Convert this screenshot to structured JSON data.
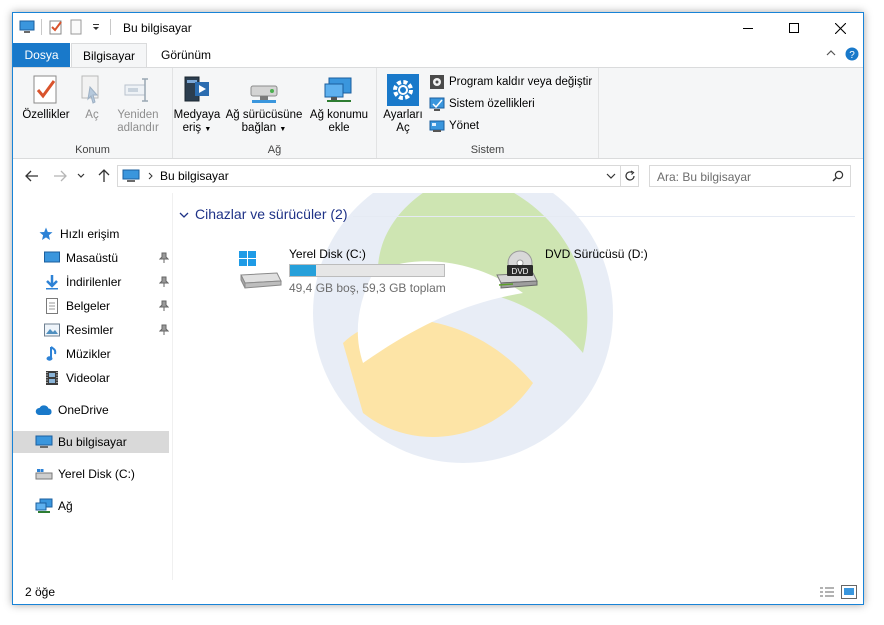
{
  "window": {
    "title": "Bu bilgisayar"
  },
  "ribbon": {
    "tabs": {
      "file": "Dosya",
      "computer": "Bilgisayar",
      "view": "Görünüm"
    },
    "groups": {
      "location": {
        "label": "Konum",
        "properties": "Özellikler",
        "open": "Aç",
        "rename_line1": "Yeniden",
        "rename_line2": "adlandır"
      },
      "network": {
        "label": "Ağ",
        "media_line1": "Medyaya",
        "media_line2": "eriş",
        "map_drive_line1": "Ağ sürücüsüne",
        "map_drive_line2": "bağlan",
        "add_location_line1": "Ağ konumu",
        "add_location_line2": "ekle"
      },
      "system": {
        "label": "Sistem",
        "settings_line1": "Ayarları",
        "settings_line2": "Aç",
        "uninstall": "Program kaldır veya değiştir",
        "system_properties": "Sistem özellikleri",
        "manage": "Yönet"
      }
    }
  },
  "address": {
    "path": "Bu bilgisayar"
  },
  "search": {
    "placeholder": "Ara: Bu bilgisayar"
  },
  "navpane": {
    "quick_access": "Hızlı erişim",
    "desktop": "Masaüstü",
    "downloads": "İndirilenler",
    "documents": "Belgeler",
    "pictures": "Resimler",
    "music": "Müzikler",
    "videos": "Videolar",
    "onedrive": "OneDrive",
    "this_pc": "Bu bilgisayar",
    "local_disk": "Yerel Disk (C:)",
    "network": "Ağ"
  },
  "content": {
    "group_header": "Cihazlar ve sürücüler (2)",
    "drives": [
      {
        "name": "Yerel Disk (C:)",
        "info": "49,4 GB boş, 59,3 GB toplam",
        "used_fraction": 0.167
      },
      {
        "name": "DVD Sürücüsü (D:)",
        "badge": "DVD"
      }
    ]
  },
  "status": {
    "item_count": "2 öğe"
  },
  "colors": {
    "accent": "#1979ca",
    "progress": "#26a0da",
    "group_header": "#1e3287",
    "selection": "#d9d9d9"
  }
}
